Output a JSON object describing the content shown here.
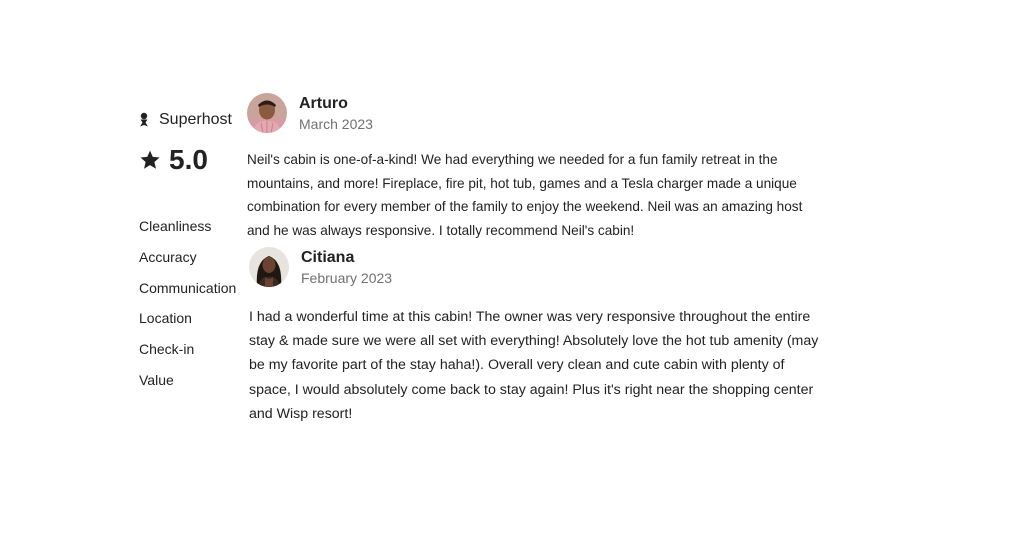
{
  "host": {
    "badge_label": "Superhost",
    "badge_icon": "superhost-icon"
  },
  "rating": {
    "icon": "star-icon",
    "overall": "5.0",
    "categories": [
      "Cleanliness",
      "Accuracy",
      "Communication",
      "Location",
      "Check-in",
      "Value"
    ]
  },
  "reviews": [
    {
      "name": "Arturo",
      "date": "March 2023",
      "text": "Neil's cabin is one-of-a-kind! We had everything we needed for a fun family retreat in the mountains, and more! Fireplace, fire pit, hot tub, games and a Tesla charger made a unique combination for every member of the family to enjoy the weekend. Neil was an amazing host and he was always responsive. I totally recommend Neil's cabin!"
    },
    {
      "name": "Citiana",
      "date": "February 2023",
      "text": "I had a wonderful time at this cabin! The owner was very responsive throughout the entire stay & made sure we were all set with everything! Absolutely love the hot tub amenity (may be my favorite part of the stay haha!). Overall very clean and cute cabin with plenty of space, I would absolutely come back to stay again! Plus it's right near the shopping center and Wisp resort!"
    }
  ]
}
